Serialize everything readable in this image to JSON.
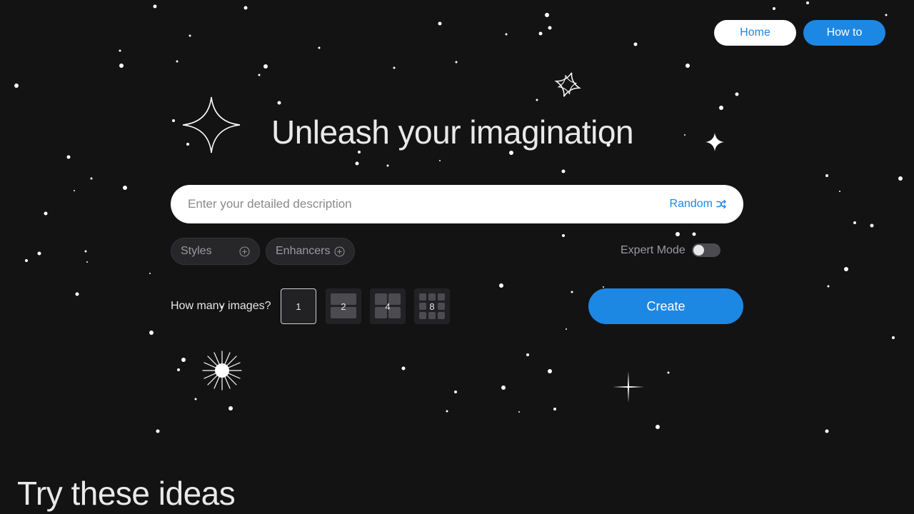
{
  "nav": {
    "home_label": "Home",
    "howto_label": "How to"
  },
  "hero": {
    "title": "Unleash your imagination"
  },
  "prompt": {
    "placeholder": "Enter your detailed description",
    "value": "",
    "random_label": "Random"
  },
  "options": {
    "styles_label": "Styles",
    "enhancers_label": "Enhancers",
    "expert_mode_label": "Expert Mode",
    "expert_mode_on": false
  },
  "image_count": {
    "label": "How many images?",
    "choices": [
      "1",
      "2",
      "4",
      "8"
    ],
    "selected": "1"
  },
  "create_label": "Create",
  "ideas_title": "Try these ideas",
  "colors": {
    "background": "#131314",
    "accent": "#1d87e4",
    "text": "#e9e9e9",
    "muted": "#9a9aa0"
  },
  "icons": {
    "random": "shuffle-icon",
    "add": "plus-circle-icon"
  }
}
